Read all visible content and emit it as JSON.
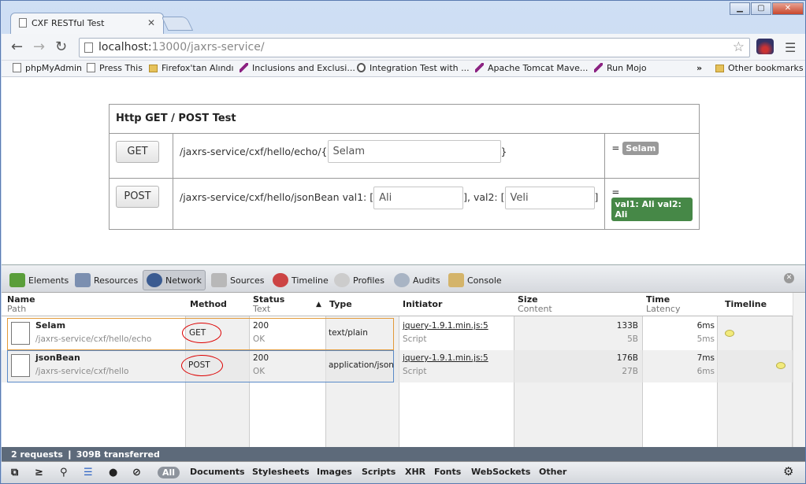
{
  "browser": {
    "tab_title": "CXF RESTful Test",
    "url_host": "localhost:",
    "url_rest": "13000/jaxrs-service/",
    "bookmarks": [
      {
        "label": "phpMyAdmin",
        "icon": "page"
      },
      {
        "label": "Press This",
        "icon": "page"
      },
      {
        "label": "Firefox'tan Alındı",
        "icon": "folder"
      },
      {
        "label": "Inclusions and Exclusi...",
        "icon": "feather"
      },
      {
        "label": "Integration Test with ...",
        "icon": "wordpress"
      },
      {
        "label": "Apache Tomcat Mave...",
        "icon": "feather"
      },
      {
        "label": "Run Mojo",
        "icon": "feather"
      }
    ],
    "bookmarks_overflow": "»",
    "other_bookmarks": "Other bookmarks"
  },
  "page": {
    "title": "Http GET / POST Test",
    "get": {
      "button": "GET",
      "path_prefix": "/jaxrs-service/cxf/hello/echo/{",
      "path_suffix": "}",
      "input_value": "Selam",
      "result_prefix": "=",
      "result": "Selam",
      "result_color": "#999999"
    },
    "post": {
      "button": "POST",
      "path_prefix": "/jaxrs-service/cxf/hello/jsonBean val1: [",
      "mid": "], val2: [",
      "path_suffix": "]",
      "val1": "Ali",
      "val2": "Veli",
      "result_prefix": "=",
      "result": "val1: Ali val2: Ali",
      "result_color": "#468847"
    }
  },
  "devtools": {
    "tabs": [
      "Elements",
      "Resources",
      "Network",
      "Sources",
      "Timeline",
      "Profiles",
      "Audits",
      "Console"
    ],
    "active_tab": "Network",
    "columns": {
      "name": "Name",
      "path": "Path",
      "method": "Method",
      "status": "Status",
      "status_text": "Text",
      "sort_arrow": "▲",
      "type": "Type",
      "initiator": "Initiator",
      "size": "Size",
      "content": "Content",
      "time": "Time",
      "latency": "Latency",
      "timeline": "Timeline"
    },
    "rows": [
      {
        "name": "Selam",
        "path": "/jaxrs-service/cxf/hello/echo",
        "method": "GET",
        "status": "200",
        "status_text": "OK",
        "type": "text/plain",
        "initiator": "jquery-1.9.1.min.js:5",
        "initiator_type": "Script",
        "size": "133B",
        "content": "5B",
        "time": "6ms",
        "latency": "5ms"
      },
      {
        "name": "jsonBean",
        "path": "/jaxrs-service/cxf/hello",
        "method": "POST",
        "status": "200",
        "status_text": "OK",
        "type": "application/json",
        "initiator": "jquery-1.9.1.min.js:5",
        "initiator_type": "Script",
        "size": "176B",
        "content": "27B",
        "time": "7ms",
        "latency": "6ms"
      }
    ],
    "summary": "2 requests  ❙  309B transferred",
    "filters": [
      "All",
      "Documents",
      "Stylesheets",
      "Images",
      "Scripts",
      "XHR",
      "Fonts",
      "WebSockets",
      "Other"
    ]
  }
}
